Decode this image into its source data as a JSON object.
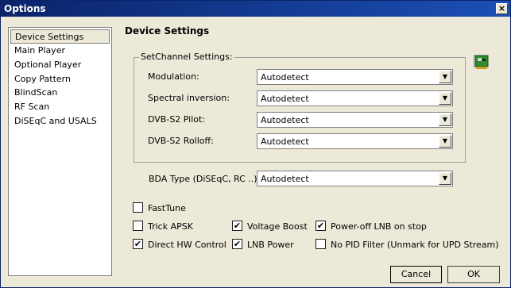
{
  "window": {
    "title": "Options",
    "close_glyph": "×"
  },
  "sidebar": {
    "items": [
      {
        "label": "Device Settings",
        "selected": true
      },
      {
        "label": "Main Player"
      },
      {
        "label": "Optional Player"
      },
      {
        "label": "Copy Pattern"
      },
      {
        "label": "BlindScan"
      },
      {
        "label": "RF Scan"
      },
      {
        "label": "DiSEqC and USALS"
      }
    ]
  },
  "main": {
    "title": "Device Settings",
    "group_label": "SetChannel Settings:",
    "fields": [
      {
        "label": "Modulation:",
        "value": "Autodetect"
      },
      {
        "label": "Spectral inversion:",
        "value": "Autodetect"
      },
      {
        "label": "DVB-S2 Pilot:",
        "value": "Autodetect"
      },
      {
        "label": "DVB-S2 Rolloff:",
        "value": "Autodetect"
      }
    ],
    "bda": {
      "label": "BDA Type (DiSEqC, RC ..):",
      "value": "Autodetect"
    },
    "checkboxes": {
      "fasttune": {
        "label": "FastTune",
        "checked": false
      },
      "trick_apsk": {
        "label": "Trick APSK",
        "checked": false
      },
      "voltage_boost": {
        "label": "Voltage Boost",
        "checked": true
      },
      "poweroff_lnb": {
        "label": "Power-off LNB on stop",
        "checked": true
      },
      "direct_hw": {
        "label": "Direct HW Control",
        "checked": true
      },
      "lnb_power": {
        "label": "LNB Power",
        "checked": true
      },
      "no_pid_filter": {
        "label": "No PID Filter (Unmark for UPD Stream)",
        "checked": false
      }
    },
    "check_glyph": "✔",
    "dropdown_glyph": "▼",
    "device_icon": "pci-card-icon"
  },
  "buttons": {
    "cancel": "Cancel",
    "ok": "OK"
  }
}
